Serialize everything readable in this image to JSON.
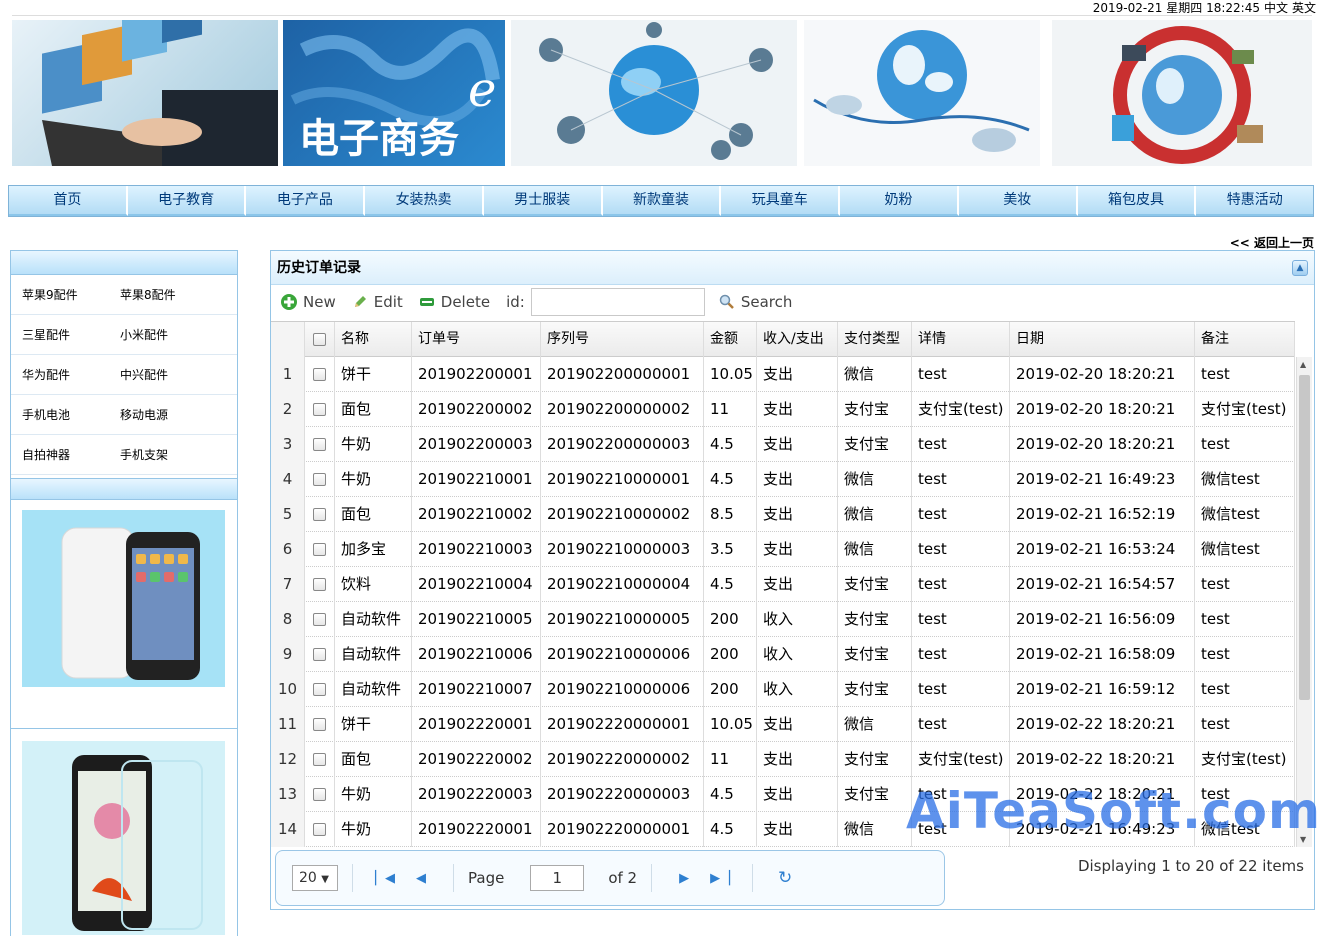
{
  "topbar": {
    "datetime": "2019-02-21 星期四 18:22:45",
    "lang_cn": "中文",
    "lang_en": "英文"
  },
  "banner": {
    "text": "电子商务"
  },
  "nav": [
    "首页",
    "电子教育",
    "电子产品",
    "女装热卖",
    "男士服装",
    "新款童装",
    "玩具童车",
    "奶粉",
    "美妆",
    "箱包皮具",
    "特惠活动"
  ],
  "back_link": "<< 返回上一页",
  "sidebar": {
    "rows": [
      [
        "苹果9配件",
        "苹果8配件"
      ],
      [
        "三星配件",
        "小米配件"
      ],
      [
        "华为配件",
        "中兴配件"
      ],
      [
        "手机电池",
        "移动电源"
      ],
      [
        "自拍神器",
        "手机支架"
      ]
    ]
  },
  "grid": {
    "title": "历史订单记录",
    "toolbar": {
      "new": "New",
      "edit": "Edit",
      "delete": "Delete",
      "id_label": "id:",
      "id_value": "",
      "search": "Search"
    },
    "columns": [
      "名称",
      "订单号",
      "序列号",
      "金额",
      "收入/支出",
      "支付类型",
      "详情",
      "日期",
      "备注"
    ],
    "rows": [
      [
        "1",
        "饼干",
        "201902200001",
        "201902200000001",
        "10.05",
        "支出",
        "微信",
        "test",
        "2019-02-20 18:20:21",
        "test"
      ],
      [
        "2",
        "面包",
        "201902200002",
        "201902200000002",
        "11",
        "支出",
        "支付宝",
        "支付宝(test)",
        "2019-02-20 18:20:21",
        "支付宝(test)"
      ],
      [
        "3",
        "牛奶",
        "201902200003",
        "201902200000003",
        "4.5",
        "支出",
        "支付宝",
        "test",
        "2019-02-20 18:20:21",
        "test"
      ],
      [
        "4",
        "牛奶",
        "201902210001",
        "201902210000001",
        "4.5",
        "支出",
        "微信",
        "test",
        "2019-02-21 16:49:23",
        "微信test"
      ],
      [
        "5",
        "面包",
        "201902210002",
        "201902210000002",
        "8.5",
        "支出",
        "微信",
        "test",
        "2019-02-21 16:52:19",
        "微信test"
      ],
      [
        "6",
        "加多宝",
        "201902210003",
        "201902210000003",
        "3.5",
        "支出",
        "微信",
        "test",
        "2019-02-21 16:53:24",
        "微信test"
      ],
      [
        "7",
        "饮料",
        "201902210004",
        "201902210000004",
        "4.5",
        "支出",
        "支付宝",
        "test",
        "2019-02-21 16:54:57",
        "test"
      ],
      [
        "8",
        "自动软件",
        "201902210005",
        "201902210000005",
        "200",
        "收入",
        "支付宝",
        "test",
        "2019-02-21 16:56:09",
        "test"
      ],
      [
        "9",
        "自动软件",
        "201902210006",
        "201902210000006",
        "200",
        "收入",
        "支付宝",
        "test",
        "2019-02-21 16:58:09",
        "test"
      ],
      [
        "10",
        "自动软件",
        "201902210007",
        "201902210000006",
        "200",
        "收入",
        "支付宝",
        "test",
        "2019-02-21 16:59:12",
        "test"
      ],
      [
        "11",
        "饼干",
        "201902220001",
        "201902220000001",
        "10.05",
        "支出",
        "微信",
        "test",
        "2019-02-22 18:20:21",
        "test"
      ],
      [
        "12",
        "面包",
        "201902220002",
        "201902220000002",
        "11",
        "支出",
        "支付宝",
        "支付宝(test)",
        "2019-02-22 18:20:21",
        "支付宝(test)"
      ],
      [
        "13",
        "牛奶",
        "201902220003",
        "201902220000003",
        "4.5",
        "支出",
        "支付宝",
        "test",
        "2019-02-22 18:20:21",
        "test"
      ],
      [
        "14",
        "牛奶",
        "201902220001",
        "201902220000001",
        "4.5",
        "支出",
        "微信",
        "test",
        "2019-02-21 16:49:23",
        "微信test"
      ]
    ],
    "pager": {
      "page_size": "20",
      "page_label": "Page",
      "page_value": "1",
      "of_label": "of 2",
      "display": "Displaying 1 to 20 of 22 items"
    }
  },
  "watermark": "AiTeaSoft.com",
  "colors": {
    "nav_bg": "#c8e8fa",
    "border": "#95c5e6",
    "accent": "#2e7fd0"
  }
}
